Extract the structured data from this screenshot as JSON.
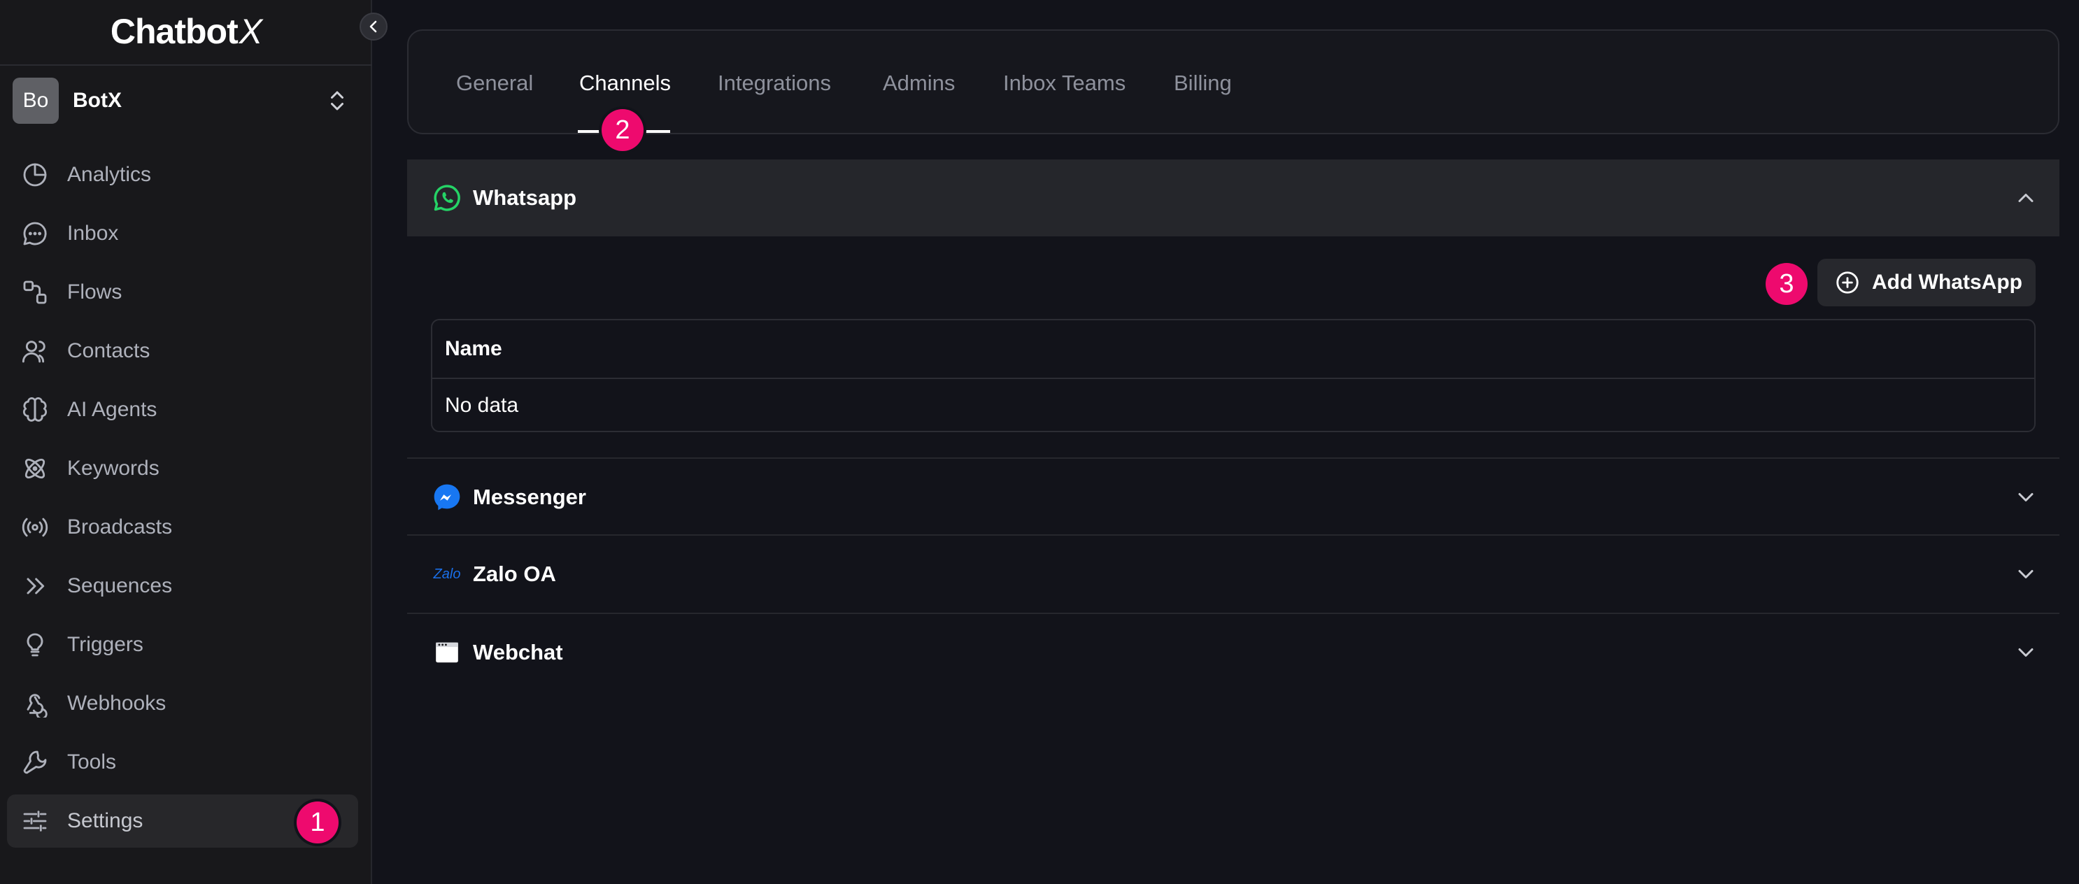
{
  "app": {
    "logo_main": "Chatbot",
    "logo_x": "X"
  },
  "workspace": {
    "avatar_initials": "Bo",
    "name": "BotX"
  },
  "sidebar": {
    "items": [
      {
        "label": "Analytics",
        "icon": "pie-chart-icon"
      },
      {
        "label": "Inbox",
        "icon": "chat-bubble-icon"
      },
      {
        "label": "Flows",
        "icon": "flow-icon"
      },
      {
        "label": "Contacts",
        "icon": "users-icon"
      },
      {
        "label": "AI Agents",
        "icon": "brain-icon"
      },
      {
        "label": "Keywords",
        "icon": "atom-icon"
      },
      {
        "label": "Broadcasts",
        "icon": "radio-icon"
      },
      {
        "label": "Sequences",
        "icon": "double-chevron-icon"
      },
      {
        "label": "Triggers",
        "icon": "lightbulb-icon"
      },
      {
        "label": "Webhooks",
        "icon": "webhook-icon"
      },
      {
        "label": "Tools",
        "icon": "wrench-icon"
      },
      {
        "label": "Settings",
        "icon": "sliders-icon",
        "active": true
      }
    ]
  },
  "tabs": [
    {
      "label": "General"
    },
    {
      "label": "Channels",
      "active": true
    },
    {
      "label": "Integrations"
    },
    {
      "label": "Admins"
    },
    {
      "label": "Inbox Teams"
    },
    {
      "label": "Billing"
    }
  ],
  "channels": {
    "whatsapp": {
      "title": "Whatsapp",
      "expanded": true,
      "add_button": "Add WhatsApp",
      "table": {
        "header": "Name",
        "empty": "No data"
      }
    },
    "messenger": {
      "title": "Messenger"
    },
    "zalo": {
      "title": "Zalo OA",
      "logo_text": "Zalo"
    },
    "webchat": {
      "title": "Webchat"
    }
  },
  "annotations": {
    "step1": "1",
    "step2": "2",
    "step3": "3"
  },
  "colors": {
    "accent_badge": "#ee0a6e",
    "whatsapp_green": "#25d366",
    "messenger_blue": "#1877f2"
  }
}
